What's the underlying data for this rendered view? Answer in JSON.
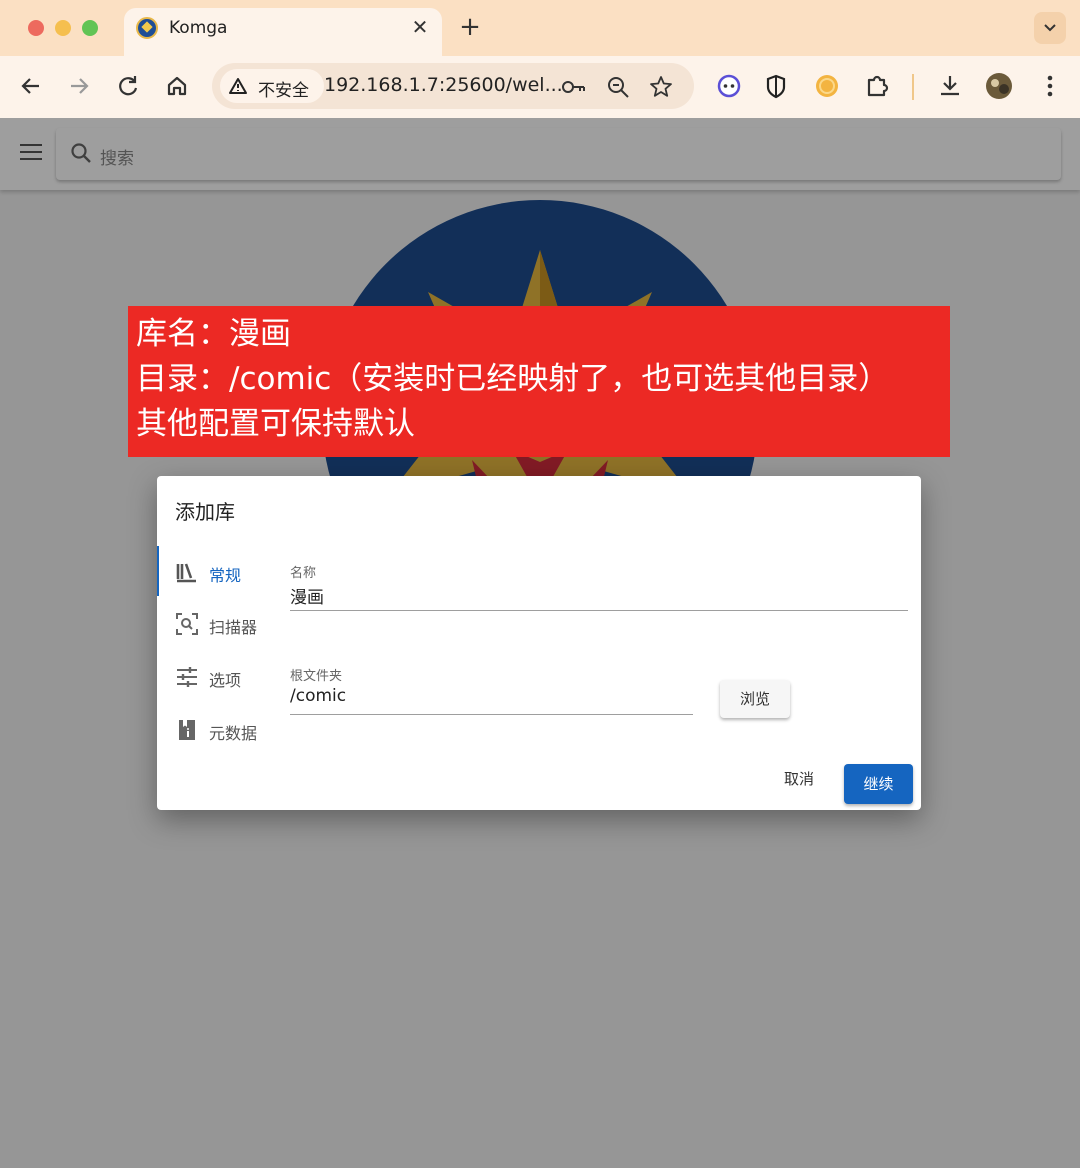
{
  "browser": {
    "tab_title": "Komga",
    "security_label": "不安全",
    "url": "192.168.1.7:25600/wel..."
  },
  "app": {
    "search_placeholder": "搜索"
  },
  "annotation": {
    "lines": [
      "库名：漫画",
      "目录：/comic（安装时已经映射了，也可选其他目录）",
      "其他配置可保持默认"
    ]
  },
  "dialog": {
    "title": "添加库",
    "nav": [
      {
        "label": "常规",
        "icon": "library-books-icon",
        "active": true
      },
      {
        "label": "扫描器",
        "icon": "scanner-icon",
        "active": false
      },
      {
        "label": "选项",
        "icon": "tune-icon",
        "active": false
      },
      {
        "label": "元数据",
        "icon": "metadata-book-icon",
        "active": false
      }
    ],
    "name_field": {
      "label": "名称",
      "value": "漫画"
    },
    "root_field": {
      "label": "根文件夹",
      "value": "/comic"
    },
    "browse_label": "浏览",
    "cancel_label": "取消",
    "continue_label": "继续"
  },
  "colors": {
    "accent": "#1565c0",
    "annotation_bg": "#ec2924",
    "logo_blue": "#1e4c8f",
    "logo_gold": "#e7b93f"
  }
}
